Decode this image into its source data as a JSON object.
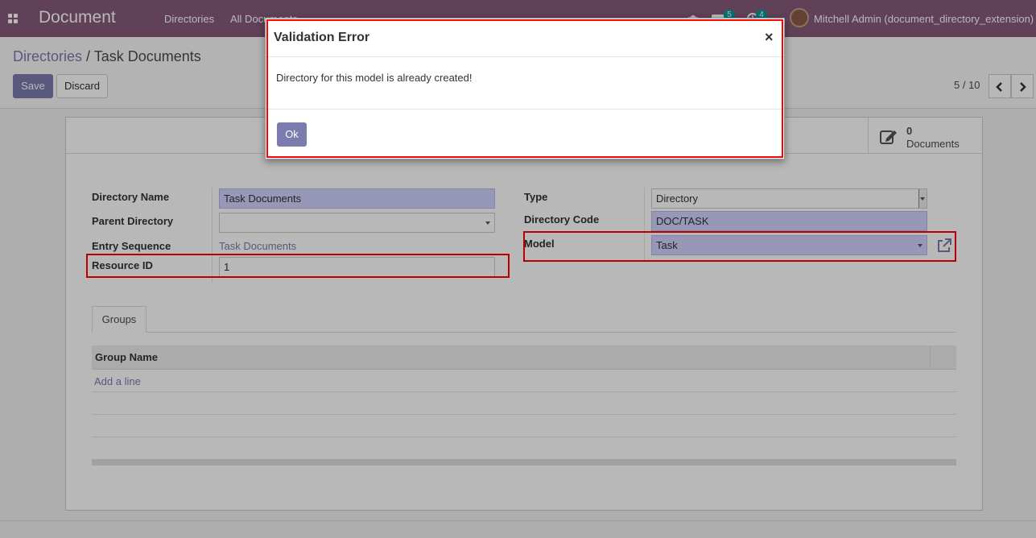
{
  "navbar": {
    "app_name": "Document",
    "menu": [
      "Directories",
      "All Documents"
    ],
    "chat_count": "5",
    "activity_count": "4",
    "user": "Mitchell Admin (document_directory_extension)"
  },
  "control_panel": {
    "breadcrumb_parent": "Directories",
    "breadcrumb_sep": " / ",
    "breadcrumb_current": "Task Documents",
    "save_label": "Save",
    "discard_label": "Discard",
    "pager": "5 / 10"
  },
  "form": {
    "stat_button": {
      "value": "0",
      "label": "Documents"
    },
    "left": {
      "directory_name_label": "Directory Name",
      "directory_name_value": "Task Documents",
      "parent_directory_label": "Parent Directory",
      "parent_directory_value": "",
      "entry_sequence_label": "Entry Sequence",
      "entry_sequence_value": "Task Documents",
      "resource_id_label": "Resource ID",
      "resource_id_value": "1"
    },
    "right": {
      "type_label": "Type",
      "type_value": "Directory",
      "directory_code_label": "Directory Code",
      "directory_code_value": "DOC/TASK",
      "model_label": "Model",
      "model_value": "Task"
    },
    "tabs": [
      {
        "label": "Groups"
      }
    ],
    "groups_table": {
      "columns": [
        "Group Name"
      ],
      "add_line": "Add a line"
    }
  },
  "modal": {
    "title": "Validation Error",
    "close": "×",
    "message": "Directory for this model is already created!",
    "ok_label": "Ok"
  },
  "colors": {
    "brand": "#875a7b",
    "primary": "#7c7bad",
    "required_field": "#d2d2ff",
    "highlight": "#ff0000",
    "badge": "#00a09d"
  }
}
